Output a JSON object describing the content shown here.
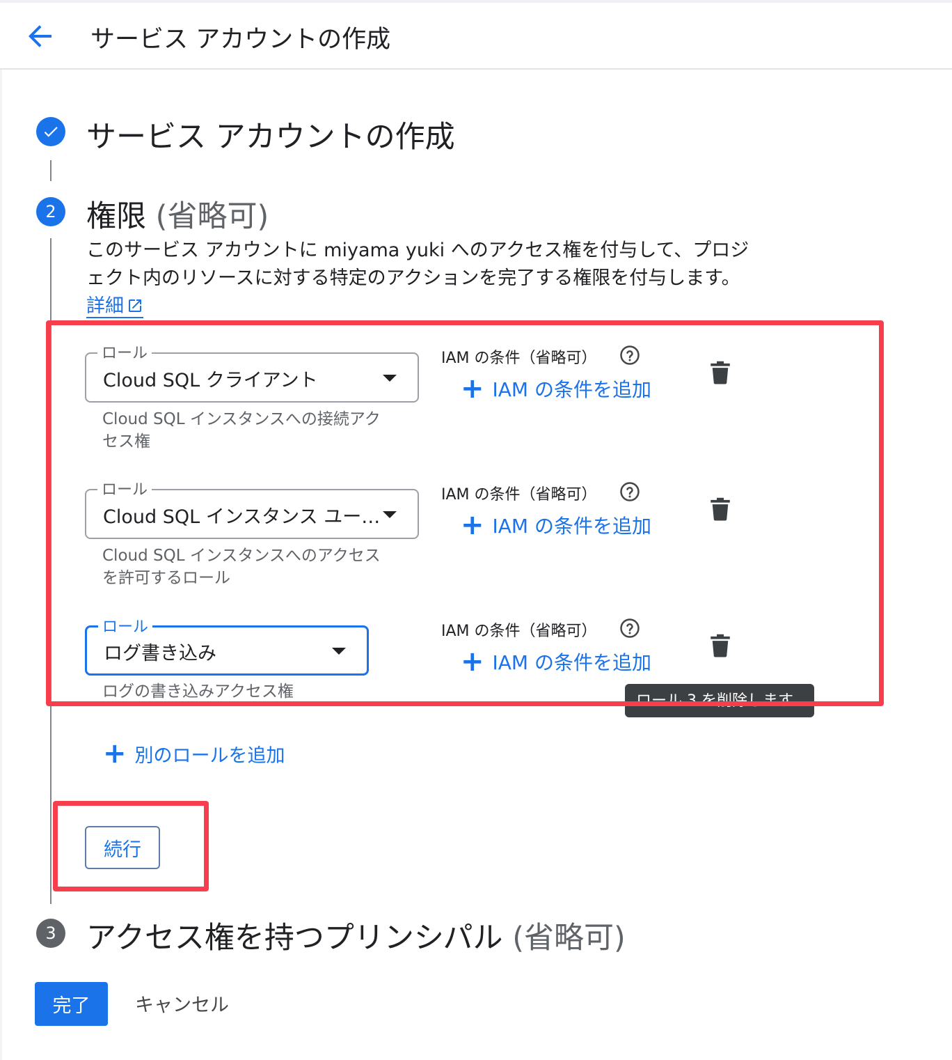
{
  "header": {
    "title": "サービス アカウントの作成"
  },
  "steps": [
    {
      "number": "✓",
      "title": "サービス アカウントの作成",
      "optional": ""
    },
    {
      "number": "2",
      "title": "権限",
      "optional": "(省略可)"
    },
    {
      "number": "3",
      "title": "アクセス権を持つプリンシパル",
      "optional": "(省略可)"
    }
  ],
  "permissions": {
    "description": "このサービス アカウントに miyama yuki へのアクセス権を付与して、プロジェクト内のリソースに対する特定のアクションを完了する権限を付与します。",
    "learn_more": "詳細",
    "roles": [
      {
        "label": "ロール",
        "value": "Cloud SQL クライアント",
        "help_line1": "Cloud SQL インスタンスへの接続アク",
        "help_line2": "セス権",
        "iam_label": "IAM の条件（省略可）",
        "add_condition": "IAM の条件を追加"
      },
      {
        "label": "ロール",
        "value": "Cloud SQL インスタンス ユー…",
        "help_line1": "Cloud SQL インスタンスへのアクセス",
        "help_line2": "を許可するロール",
        "iam_label": "IAM の条件（省略可）",
        "add_condition": "IAM の条件を追加"
      },
      {
        "label": "ロール",
        "value": "ログ書き込み",
        "help_line1": "ログの書き込みアクセス権",
        "help_line2": "",
        "iam_label": "IAM の条件（省略可）",
        "add_condition": "IAM の条件を追加"
      }
    ],
    "tooltip": "ロール 3 を削除します",
    "add_role": "別のロールを追加",
    "continue": "続行"
  },
  "footer": {
    "done": "完了",
    "cancel": "キャンセル"
  },
  "colors": {
    "accent": "#1a73e8",
    "highlight": "#f63e4c",
    "tooltip_bg": "#3c4043"
  }
}
